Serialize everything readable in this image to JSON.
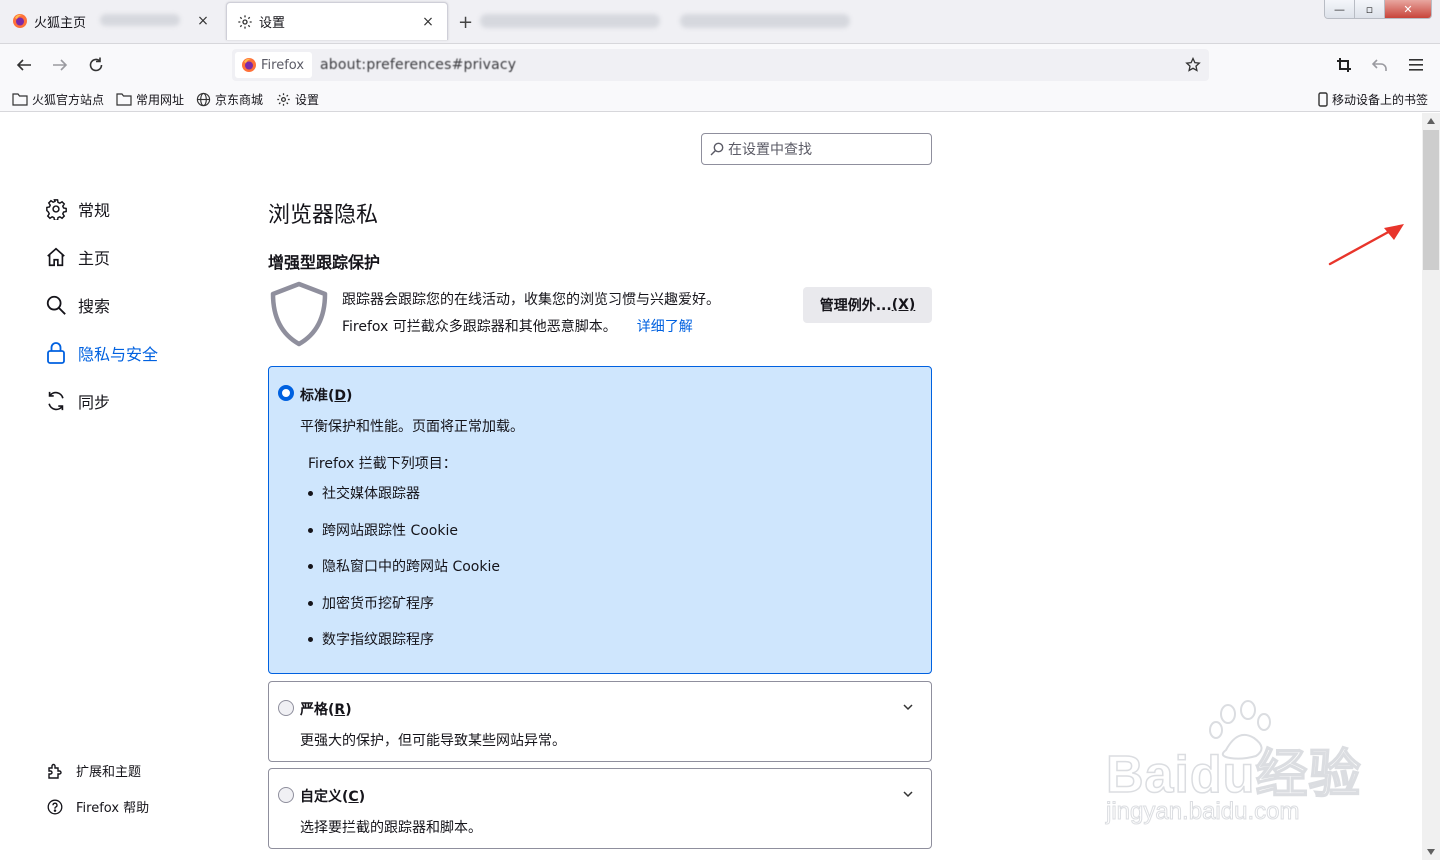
{
  "tabs": [
    {
      "label": "火狐主页",
      "close": "×",
      "icon": "firefox-logo-icon"
    },
    {
      "label": "设置",
      "close": "×",
      "icon": "gear-icon"
    }
  ],
  "new_tab": "+",
  "window_controls": {
    "minimize": "—",
    "restore": "▫",
    "close": "✕"
  },
  "urlbar": {
    "identity": "Firefox",
    "url": "about:preferences#privacy"
  },
  "bookmarks": [
    {
      "label": "火狐官方站点",
      "icon": "folder-icon"
    },
    {
      "label": "常用网址",
      "icon": "folder-icon"
    },
    {
      "label": "京东商城",
      "icon": "globe-icon"
    },
    {
      "label": "设置",
      "icon": "gear-icon"
    }
  ],
  "mobile_bookmarks": "移动设备上的书签",
  "search": {
    "placeholder": "在设置中查找"
  },
  "categories": [
    {
      "label": "常规",
      "icon": "gear-icon"
    },
    {
      "label": "主页",
      "icon": "home-icon"
    },
    {
      "label": "搜索",
      "icon": "search-icon"
    },
    {
      "label": "隐私与安全",
      "icon": "lock-icon",
      "active": true
    },
    {
      "label": "同步",
      "icon": "sync-icon"
    }
  ],
  "footer_links": [
    {
      "label": "扩展和主题",
      "icon": "puzzle-icon"
    },
    {
      "label": "Firefox 帮助",
      "icon": "help-icon"
    }
  ],
  "page_title": "浏览器隐私",
  "etp": {
    "title": "增强型跟踪保护",
    "desc1": "跟踪器会跟踪您的在线活动，收集您的浏览习惯与兴趣爱好。",
    "desc2": "Firefox 可拦截众多跟踪器和其他恶意脚本。",
    "learn_more": "详细了解",
    "manage_button": {
      "label": "管理例外...",
      "accesskey": "(X)"
    }
  },
  "options": {
    "standard": {
      "label": "标准",
      "accesskey": "D",
      "desc": "平衡保护和性能。页面将正常加载。",
      "blocks_title": "Firefox 拦截下列项目：",
      "blocks": [
        "社交媒体跟踪器",
        "跨网站跟踪性 Cookie",
        "隐私窗口中的跨网站 Cookie",
        "加密货币挖矿程序",
        "数字指纹跟踪程序"
      ],
      "selected": true
    },
    "strict": {
      "label": "严格",
      "accesskey": "R",
      "desc": "更强大的保护，但可能导致某些网站异常。",
      "selected": false
    },
    "custom": {
      "label": "自定义",
      "accesskey": "C",
      "desc": "选择要拦截的跟踪器和脚本。",
      "selected": false
    }
  },
  "colors": {
    "accent": "#0061e0",
    "selected_bg": "#cfe6fd",
    "annotation": "#e8352b"
  },
  "watermark": {
    "logo": "Bai",
    "logo_suffix": "du",
    "product": "经验",
    "url": "jingyan.baidu.com"
  }
}
